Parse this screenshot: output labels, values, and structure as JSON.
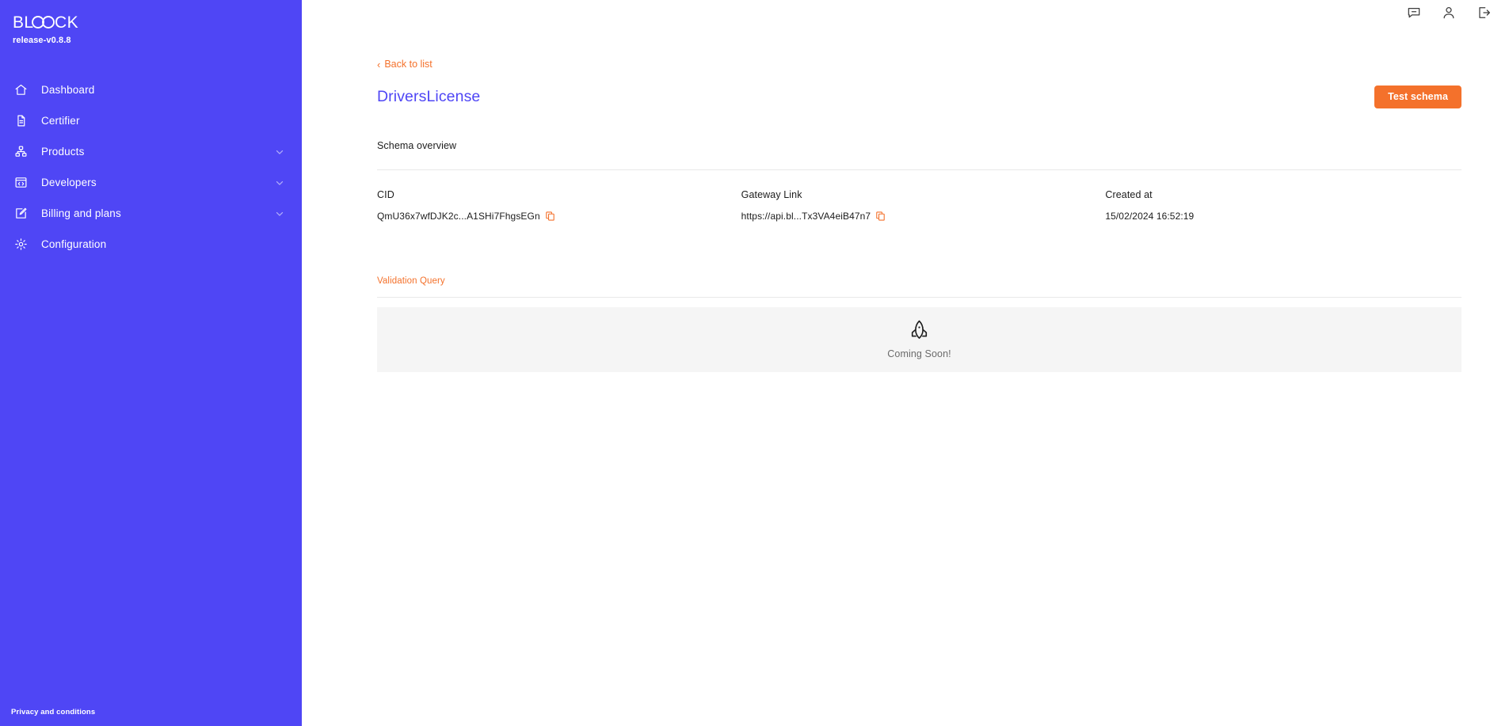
{
  "brand": {
    "logo_text": "BLOOCK",
    "release": "release-v0.8.8",
    "sidebar_color": "#4F46F5",
    "accent_color": "#F4712B"
  },
  "sidebar": {
    "items": [
      {
        "label": "Dashboard",
        "icon": "home-icon",
        "expandable": false
      },
      {
        "label": "Certifier",
        "icon": "document-icon",
        "expandable": false
      },
      {
        "label": "Products",
        "icon": "hierarchy-icon",
        "expandable": true
      },
      {
        "label": "Developers",
        "icon": "code-icon",
        "expandable": true
      },
      {
        "label": "Billing and plans",
        "icon": "edit-icon",
        "expandable": true
      },
      {
        "label": "Configuration",
        "icon": "gear-icon",
        "expandable": false
      }
    ],
    "footer": "Privacy and conditions"
  },
  "topbar": {
    "icons": [
      {
        "name": "chat-icon"
      },
      {
        "name": "user-icon"
      },
      {
        "name": "logout-icon"
      }
    ]
  },
  "main": {
    "back_link": "Back to list",
    "back_chevron": "‹",
    "page_title": "DriversLicense",
    "test_schema_label": "Test schema",
    "section_label": "Schema overview",
    "fields": [
      {
        "label": "CID",
        "value": "QmU36x7wfDJK2c...A1SHi7FhgsEGn",
        "copyable": true
      },
      {
        "label": "Gateway Link",
        "value": "https://api.bl...Tx3VA4eiB47n7",
        "copyable": true
      },
      {
        "label": "Created at",
        "value": "15/02/2024 16:52:19",
        "copyable": false
      }
    ],
    "tab_label": "Validation Query",
    "coming_soon_text": "Coming Soon!",
    "coming_soon_icon": "rocket-icon"
  }
}
